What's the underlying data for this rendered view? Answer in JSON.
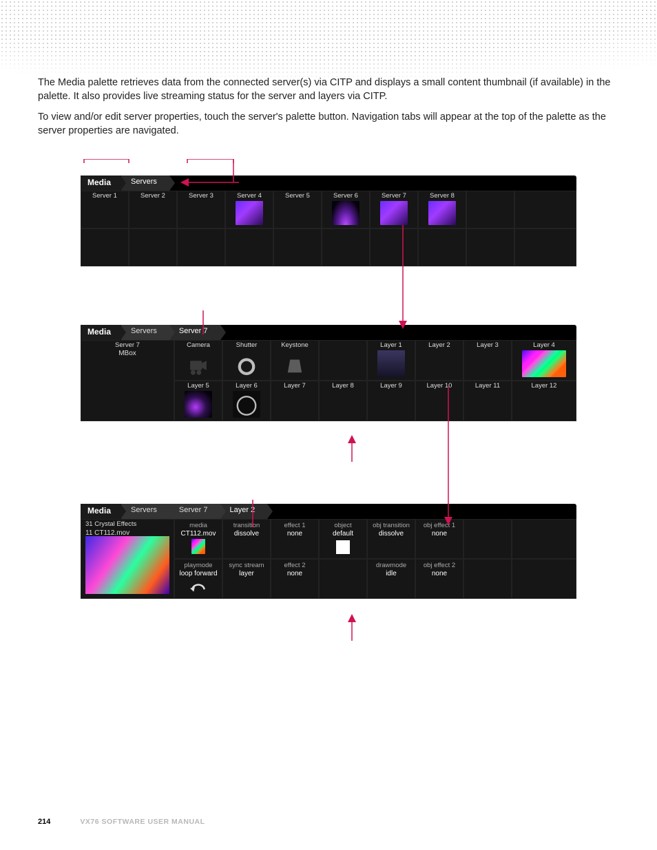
{
  "text": {
    "para1": "The Media palette retrieves data from the connected server(s) via CITP and displays a small content thumbnail (if available) in the palette. It also provides live streaming status for the server and layers via CITP.",
    "para2": "To view and/or edit server properties, touch the server's palette button. Navigation tabs will appear at the top of the palette as the server properties are navigated."
  },
  "panel1": {
    "crumbs": [
      "Media",
      "Servers"
    ],
    "row1": [
      "Server 1",
      "Server 2",
      "Server 3",
      "Server 4",
      "Server 5",
      "Server 6",
      "Server 7",
      "Server 8",
      "",
      ""
    ]
  },
  "panel2": {
    "crumbs": [
      "Media",
      "Servers",
      "Server 7"
    ],
    "big": {
      "title": "Server 7",
      "sub": "MBox"
    },
    "row1": [
      "Camera",
      "Shutter",
      "Keystone",
      "",
      "Layer 1",
      "Layer 2",
      "Layer 3",
      "Layer 4"
    ],
    "row2": [
      "Layer 5",
      "Layer 6",
      "Layer 7",
      "Layer 8",
      "Layer 9",
      "Layer 10",
      "Layer 11",
      "Layer 12"
    ]
  },
  "panel3": {
    "crumbs": [
      "Media",
      "Servers",
      "Server 7",
      "Layer 2"
    ],
    "big": {
      "line1": "31 Crystal Effects",
      "line2": "11 CT112.mov"
    },
    "rowA": [
      {
        "k": "media",
        "v": "CT112.mov",
        "thumb": "mini"
      },
      {
        "k": "transition",
        "v": "dissolve"
      },
      {
        "k": "effect 1",
        "v": "none"
      },
      {
        "k": "object",
        "v": "default",
        "thumb": "white"
      },
      {
        "k": "obj transition",
        "v": "dissolve"
      },
      {
        "k": "obj effect 1",
        "v": "none"
      },
      {
        "k": "",
        "v": ""
      },
      {
        "k": "",
        "v": ""
      }
    ],
    "rowB": [
      {
        "k": "playmode",
        "v": "loop forward",
        "thumb": "loop"
      },
      {
        "k": "sync stream",
        "v": "layer"
      },
      {
        "k": "effect 2",
        "v": "none"
      },
      {
        "k": "",
        "v": ""
      },
      {
        "k": "drawmode",
        "v": "idle"
      },
      {
        "k": "obj effect 2",
        "v": "none"
      },
      {
        "k": "",
        "v": ""
      },
      {
        "k": "",
        "v": ""
      }
    ]
  },
  "footer": {
    "page": "214",
    "title": "VX76 SOFTWARE USER MANUAL"
  },
  "colors": {
    "annot": "#d01252"
  }
}
